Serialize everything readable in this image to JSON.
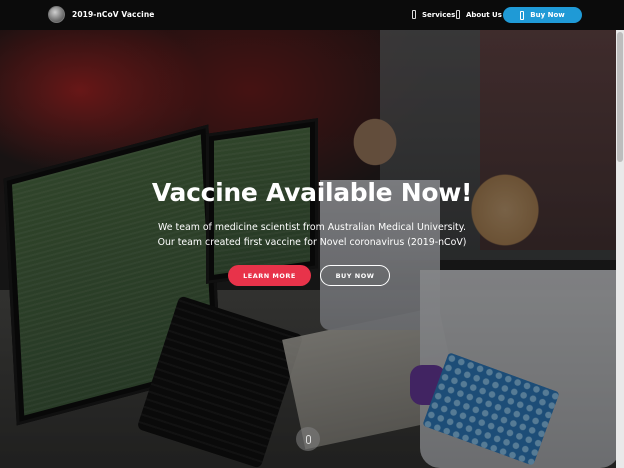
{
  "navbar": {
    "brand": "2019-nCoV Vaccine",
    "links": [
      {
        "label": "Services",
        "icon": "document-icon"
      },
      {
        "label": "About Us",
        "icon": "document-icon"
      }
    ],
    "buy_label": "Buy Now",
    "buy_icon": "mobile-icon",
    "accent_color": "#1f9ad6"
  },
  "hero": {
    "title": "Vaccine Available Now!",
    "subtitle_line1": "We team of medicine scientist from Australian Medical University.",
    "subtitle_line2": "Our team created first vaccine for Novel coronavirus (2019-nCoV)",
    "learn_more_label": "LEARN MORE",
    "buy_now_label": "BUY NOW",
    "learn_more_color": "#e8334a",
    "scroll_icon": "mouse-icon"
  }
}
